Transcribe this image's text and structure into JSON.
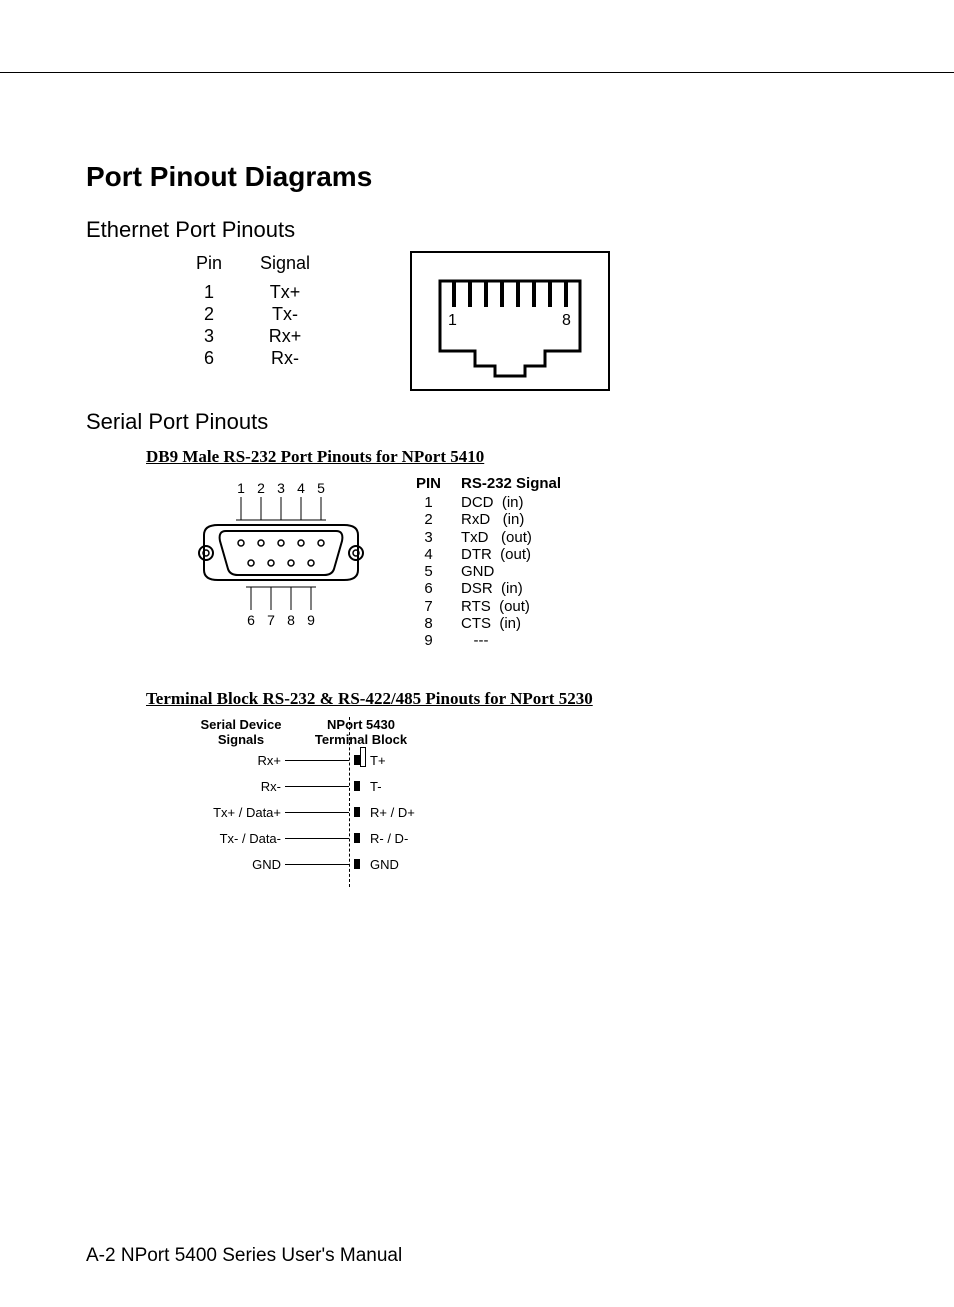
{
  "title": "Port Pinout Diagrams",
  "ethernet": {
    "heading": "Ethernet Port Pinouts",
    "col_pin": "Pin",
    "col_signal": "Signal",
    "rows": [
      {
        "pin": "1",
        "signal": "Tx+"
      },
      {
        "pin": "2",
        "signal": "Tx-"
      },
      {
        "pin": "3",
        "signal": "Rx+"
      },
      {
        "pin": "6",
        "signal": "Rx-"
      }
    ],
    "jack_left": "1",
    "jack_right": "8"
  },
  "serial": {
    "heading": "Serial Port Pinouts",
    "db9": {
      "title": "DB9 Male RS-232 Port Pinouts for NPort 5410",
      "top_nums": [
        "1",
        "2",
        "3",
        "4",
        "5"
      ],
      "bottom_nums": [
        "6",
        "7",
        "8",
        "9"
      ],
      "col_pin": "PIN",
      "col_signal": "RS-232 Signal",
      "rows": [
        {
          "pin": "1",
          "signal": "DCD  (in)"
        },
        {
          "pin": "2",
          "signal": "RxD   (in)"
        },
        {
          "pin": "3",
          "signal": "TxD   (out)"
        },
        {
          "pin": "4",
          "signal": "DTR  (out)"
        },
        {
          "pin": "5",
          "signal": "GND"
        },
        {
          "pin": "6",
          "signal": "DSR  (in)"
        },
        {
          "pin": "7",
          "signal": "RTS  (out)"
        },
        {
          "pin": "8",
          "signal": "CTS  (in)"
        },
        {
          "pin": "9",
          "signal": "   ---"
        }
      ]
    },
    "tb": {
      "title": "Terminal Block RS-232 & RS-422/485 Pinouts for NPort 5230",
      "left_header_l1": "Serial Device",
      "left_header_l2": "Signals",
      "right_header_l1": "NPort 5430",
      "right_header_l2": "Terminal Block",
      "rows": [
        {
          "left": "Rx+",
          "right": "T+"
        },
        {
          "left": "Rx-",
          "right": "T-"
        },
        {
          "left": "Tx+ / Data+",
          "right": "R+ / D+"
        },
        {
          "left": "Tx- / Data-",
          "right": "R- / D-"
        },
        {
          "left": "GND",
          "right": "GND"
        }
      ]
    }
  },
  "footer": "A-2   NPort 5400 Series User's Manual"
}
